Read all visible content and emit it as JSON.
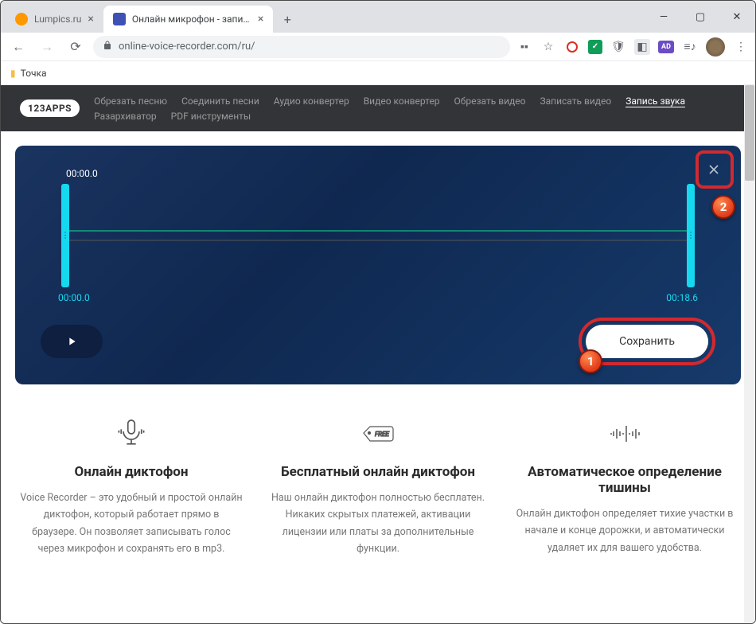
{
  "window": {
    "minimize": "—",
    "maximize": "▢",
    "close": "✕"
  },
  "tabs": [
    {
      "title": "Lumpics.ru",
      "active": false
    },
    {
      "title": "Онлайн микрофон - запись гол",
      "active": true
    }
  ],
  "address": {
    "url": "online-voice-recorder.com/ru/",
    "back": "←",
    "forward": "→",
    "reload": "⟳"
  },
  "bookmarks": {
    "folder": "Точка"
  },
  "header": {
    "logo": "123APPS",
    "links": [
      "Обрезать песню",
      "Соединить песни",
      "Аудио конвертер",
      "Видео конвертер",
      "Обрезать видео",
      "Записать видео",
      "Запись звука",
      "Разархиватор",
      "PDF инструменты"
    ],
    "active_index": 6
  },
  "recorder": {
    "timer_top": "00:00.0",
    "time_start": "00:00.0",
    "time_end": "00:18.6",
    "save": "Сохранить"
  },
  "markers": {
    "one": "1",
    "two": "2"
  },
  "features": [
    {
      "title": "Онлайн диктофон",
      "desc": "Voice Recorder – это удобный и простой онлайн диктофон, который работает прямо в браузере. Он позволяет записывать голос через микрофон и сохранять его в mp3."
    },
    {
      "title": "Бесплатный онлайн диктофон",
      "desc": "Наш онлайн диктофон полностью бесплатен. Никаких скрытых платежей, активации лицензии или платы за дополнительные функции."
    },
    {
      "title": "Автоматическое определение тишины",
      "desc": "Онлайн диктофон определяет тихие участки в начале и конце дорожки, и автоматически удаляет их для вашего удобства."
    }
  ]
}
